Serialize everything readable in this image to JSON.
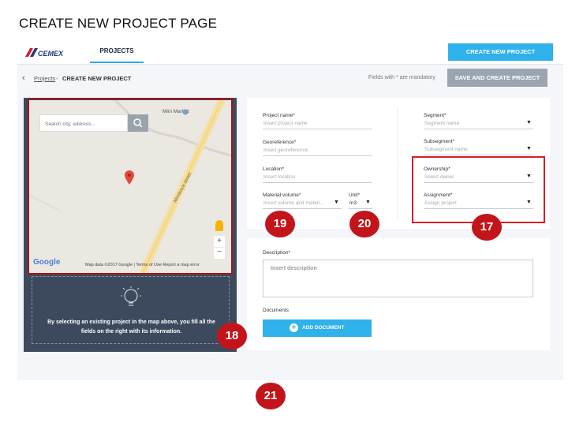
{
  "page_title": "CREATE NEW PROJECT PAGE",
  "topbar": {
    "logo_text": "CEMEX",
    "nav_projects": "PROJECTS",
    "create_button": "CREATE NEW PROJECT"
  },
  "breadcrumb": {
    "back_glyph": "‹",
    "projects": "Projects",
    "separator": "-",
    "current": "CREATE NEW PROJECT",
    "mandatory_note": "Fields with * are mandatory",
    "save_button": "SAVE AND CREATE PROJECT"
  },
  "map": {
    "search_placeholder": "Search city, address...",
    "poi": "Mini Market",
    "street": "Minskaya street",
    "google": "Google",
    "footer": "Map data ©2017 Google | Terms of Use   Report a map error",
    "zoom_in": "+",
    "zoom_out": "−"
  },
  "drop_zone": {
    "text": "By selecting an existing project in the map above, you fill all the fields on the right with its information."
  },
  "form": {
    "project_name_label": "Project name*",
    "project_name_placeholder": "Insert project name",
    "georeference_label": "Georeference*",
    "georeference_placeholder": "Insert georeference",
    "location_label": "Location*",
    "location_placeholder": "Insert location",
    "material_volume_label": "Material volume*",
    "material_volume_placeholder": "Insert volume and materi...",
    "unit_label": "Unit*",
    "unit_value": "m3",
    "segment_label": "Segment*",
    "segment_placeholder": "Segment name",
    "subsegment_label": "Subsegment*",
    "subsegment_placeholder": "Subsegment name",
    "ownership_label": "Ownership*",
    "ownership_placeholder": "Select owner",
    "assignment_label": "Assignment*",
    "assignment_placeholder": "Assign project"
  },
  "description": {
    "label": "Description*",
    "placeholder": "Insert description",
    "documents_label": "Documents",
    "add_document_button": "ADD DOCUMENT"
  },
  "annotations": {
    "b17": "17",
    "b18": "18",
    "b19": "19",
    "b20": "20",
    "b21": "21"
  },
  "colors": {
    "accent": "#2fb1ec",
    "annotation": "#c2141a",
    "left_panel": "#3d4a5e"
  }
}
